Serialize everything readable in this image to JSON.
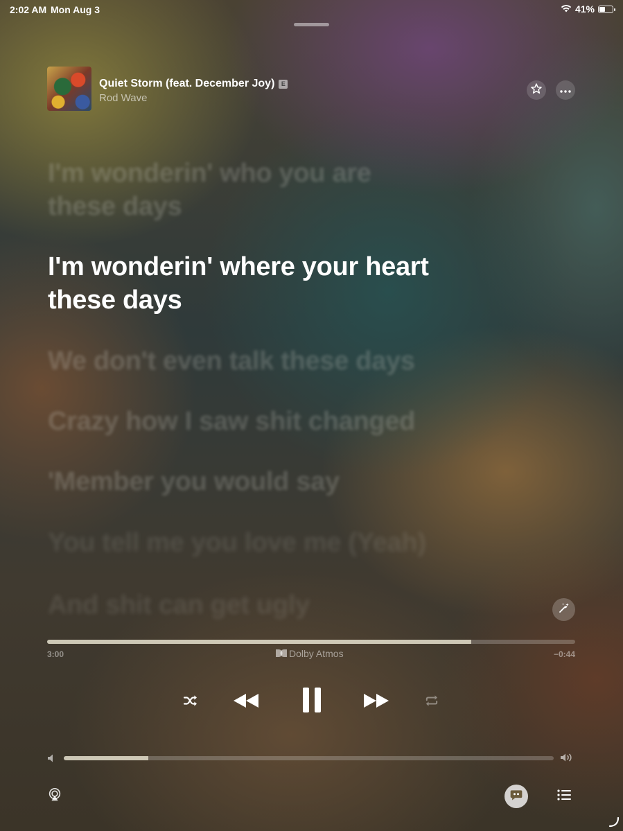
{
  "status_bar": {
    "time": "2:02 AM",
    "date": "Mon Aug 3",
    "battery_percent": "41%",
    "battery_level": 0.41
  },
  "now_playing": {
    "title": "Quiet Storm (feat. December Joy)",
    "explicit_badge": "E",
    "artist": "Rod Wave"
  },
  "lyrics": {
    "previous": [
      "I'm wonderin' who you are",
      "these days"
    ],
    "current": [
      "I'm wonderin' where your heart",
      "these days"
    ],
    "upcoming": [
      "We don't even talk these days",
      "Crazy how I saw shit changed",
      "'Member you would say",
      "You tell me you love me (Yeah)",
      "And shit can get ugly"
    ]
  },
  "playback": {
    "elapsed": "3:00",
    "remaining": "−0:44",
    "progress_fraction": 0.803,
    "audio_format": "Dolby Atmos"
  },
  "volume": {
    "level_fraction": 0.173
  },
  "icons": {
    "star": "star-icon",
    "more": "ellipsis-icon",
    "sing": "magic-wand-icon",
    "shuffle": "shuffle-icon",
    "previous": "rewind-icon",
    "pause": "pause-icon",
    "next": "fast-forward-icon",
    "repeat": "repeat-icon",
    "airplay": "airplay-icon",
    "lyrics": "lyrics-bubble-icon",
    "queue": "list-icon"
  },
  "colors": {
    "lyric_active": "#ffffff",
    "lyric_inactive": "rgba(220,220,210,0.22)"
  }
}
